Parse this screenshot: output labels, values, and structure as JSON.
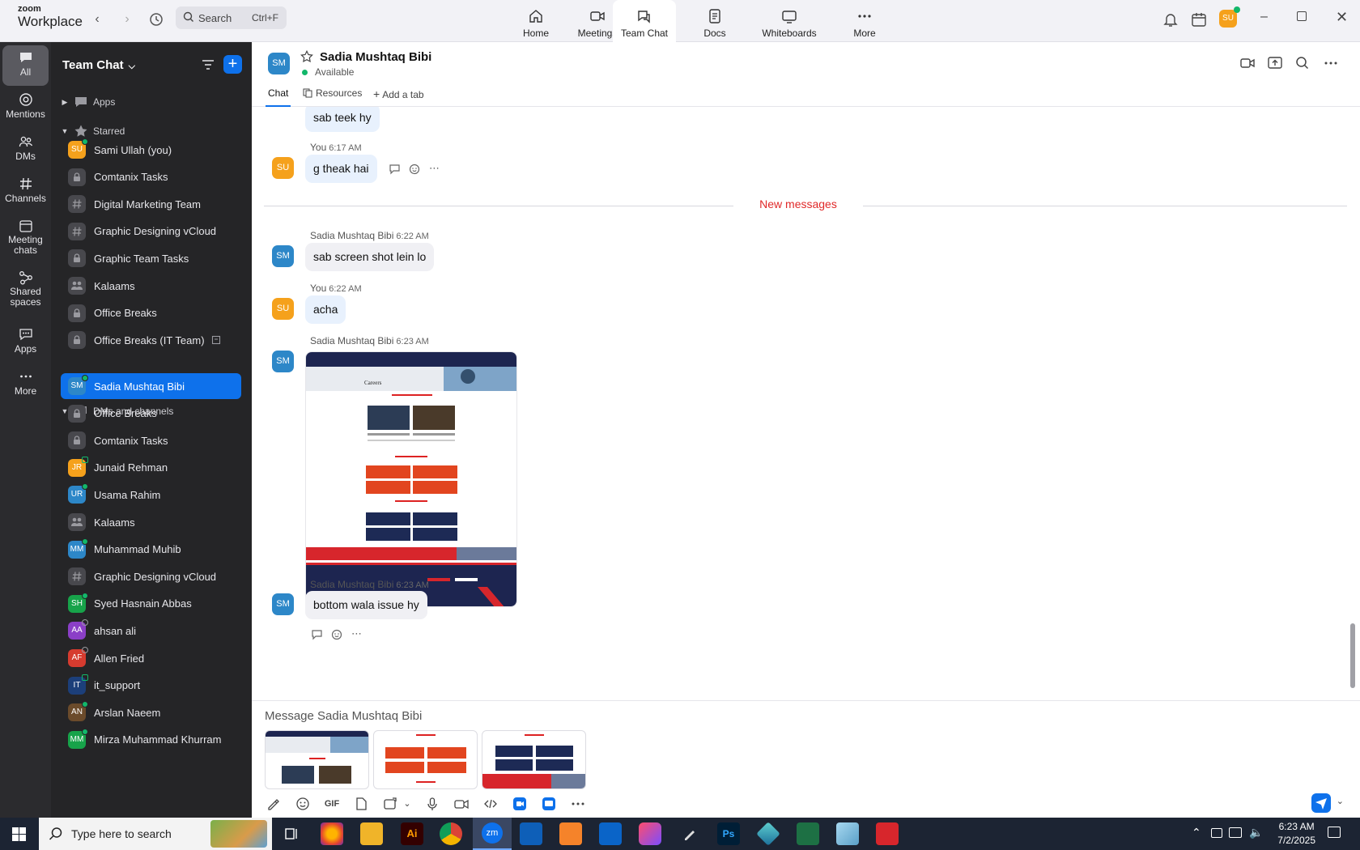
{
  "app": {
    "logo_top": "zoom",
    "logo_bottom": "Workplace"
  },
  "search": {
    "placeholder": "Search",
    "shortcut": "Ctrl+F"
  },
  "tabs": [
    {
      "label": "Home",
      "icon": "home-icon"
    },
    {
      "label": "Meetings",
      "icon": "video-icon"
    },
    {
      "label": "Team Chat",
      "icon": "chat-icon",
      "active": true
    },
    {
      "label": "Docs",
      "icon": "doc-icon"
    },
    {
      "label": "Whiteboards",
      "icon": "whiteboard-icon"
    },
    {
      "label": "More",
      "icon": "more-icon"
    }
  ],
  "user": {
    "initials": "SU",
    "color": "#f5a11c"
  },
  "rail": [
    {
      "label": "All",
      "icon": "chat-bubble-icon",
      "active": true
    },
    {
      "label": "Mentions",
      "icon": "at-icon"
    },
    {
      "label": "DMs",
      "icon": "people-icon"
    },
    {
      "label": "Channels",
      "icon": "hash-icon"
    },
    {
      "label": "Meeting chats",
      "line1": "Meeting",
      "line2": "chats",
      "icon": "calendar-icon"
    },
    {
      "label": "Shared spaces",
      "line1": "Shared",
      "line2": "spaces",
      "icon": "share-icon"
    },
    {
      "label": "Apps",
      "icon": "apps-icon"
    },
    {
      "label": "More",
      "icon": "ellipsis-icon"
    }
  ],
  "sidebar": {
    "title": "Team Chat",
    "sections": {
      "apps": "Apps",
      "starred": "Starred",
      "dms": "DMs and channels"
    },
    "starred": [
      {
        "name": "Sami Ullah (you)",
        "type": "person",
        "initials": "SU",
        "color": "#f5a11c",
        "status": "online"
      },
      {
        "name": "Comtanix Tasks",
        "type": "lock"
      },
      {
        "name": "Digital Marketing Team",
        "type": "hash"
      },
      {
        "name": "Graphic Designing vCloud",
        "type": "hash"
      },
      {
        "name": "Graphic Team Tasks",
        "type": "lock"
      },
      {
        "name": "Kalaams",
        "type": "group"
      },
      {
        "name": "Office Breaks",
        "type": "lock"
      },
      {
        "name": "Office Breaks (IT Team)",
        "type": "lock",
        "tail": true
      }
    ],
    "dms": [
      {
        "name": "Sadia Mushtaq Bibi",
        "type": "person",
        "initials": "SM",
        "color": "#2d87c8",
        "status": "online",
        "active": true
      },
      {
        "name": "Office Breaks",
        "type": "lock"
      },
      {
        "name": "Comtanix Tasks",
        "type": "lock"
      },
      {
        "name": "Junaid Rehman",
        "type": "person",
        "initials": "JR",
        "color": "#f5a11c",
        "status": "mobile"
      },
      {
        "name": "Usama Rahim",
        "type": "person",
        "initials": "UR",
        "color": "#2d87c8",
        "status": "online"
      },
      {
        "name": "Kalaams",
        "type": "group"
      },
      {
        "name": "Muhammad Muhib",
        "type": "person",
        "initials": "MM",
        "color": "#2d87c8",
        "status": "online"
      },
      {
        "name": "Graphic Designing vCloud",
        "type": "hash"
      },
      {
        "name": "Syed Hasnain Abbas",
        "type": "person",
        "initials": "SH",
        "color": "#17a34a",
        "status": "online"
      },
      {
        "name": "ahsan ali",
        "type": "person",
        "initials": "AA",
        "color": "#8b3fc7",
        "status": "offline"
      },
      {
        "name": "Allen Fried",
        "type": "person",
        "initials": "AF",
        "color": "#d63b2f",
        "status": "offline"
      },
      {
        "name": "it_support",
        "type": "person",
        "initials": "IT",
        "color": "#1c3f7a",
        "status": "mobile"
      },
      {
        "name": "Arslan Naeem",
        "type": "person",
        "initials": "AN",
        "color": "#6b4b2b",
        "status": "online"
      },
      {
        "name": "Mirza Muhammad Khurram",
        "type": "person",
        "initials": "MM",
        "color": "#17a34a",
        "status": "online"
      }
    ]
  },
  "chat": {
    "name": "Sadia Mushtaq Bibi",
    "initials": "SM",
    "status": "Available",
    "tabs": [
      "Chat",
      "Resources",
      "Add a tab"
    ]
  },
  "messages": {
    "m0": {
      "text": "sab teek hy"
    },
    "m1": {
      "sender": "You",
      "time": "6:17 AM",
      "text": "g theak hai"
    },
    "new_label": "New messages",
    "m2": {
      "sender": "Sadia Mushtaq Bibi",
      "time": "6:22 AM",
      "text": "sab screen shot lein lo"
    },
    "m3": {
      "sender": "You",
      "time": "6:22 AM",
      "text": "acha"
    },
    "m4": {
      "sender": "Sadia Mushtaq Bibi",
      "time": "6:23 AM"
    },
    "m5": {
      "sender": "Sadia Mushtaq Bibi",
      "time": "6:23 AM",
      "text": "bottom wala issue hy"
    },
    "shot_heading": "Careers"
  },
  "composer": {
    "placeholder": "Message Sadia Mushtaq Bibi",
    "gif": "GIF"
  },
  "taskbar": {
    "search_placeholder": "Type here to search",
    "time": "6:23 AM",
    "date": "7/2/2025"
  }
}
